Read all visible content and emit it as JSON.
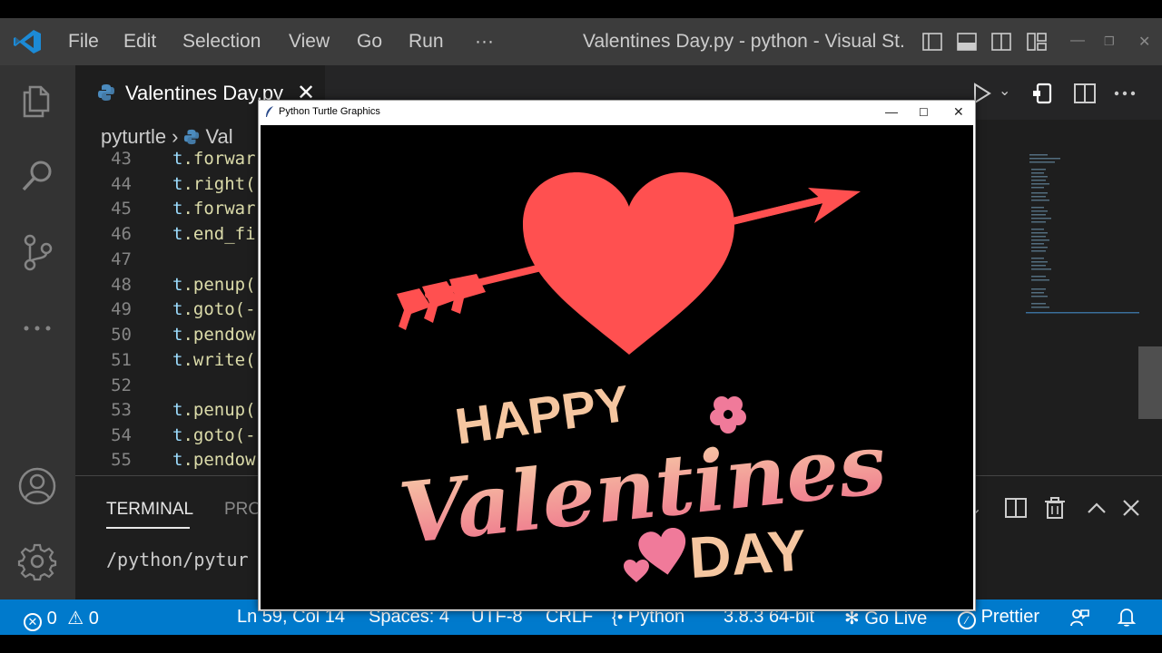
{
  "window": {
    "title": "Valentines Day.py - python - Visual St...",
    "menu": [
      "File",
      "Edit",
      "Selection",
      "View",
      "Go",
      "Run",
      "···"
    ]
  },
  "tab": {
    "label": "Valentines Day.py"
  },
  "breadcrumb": {
    "folder": "pyturtle",
    "file": "Val"
  },
  "code_lines": [
    {
      "num": "43",
      "obj": "t",
      "rest": ".forwar"
    },
    {
      "num": "44",
      "obj": "t",
      "rest": ".right("
    },
    {
      "num": "45",
      "obj": "t",
      "rest": ".forwar"
    },
    {
      "num": "46",
      "obj": "t",
      "rest": ".end_fi"
    },
    {
      "num": "47",
      "obj": "",
      "rest": ""
    },
    {
      "num": "48",
      "obj": "t",
      "rest": ".penup("
    },
    {
      "num": "49",
      "obj": "t",
      "rest": ".goto(-"
    },
    {
      "num": "50",
      "obj": "t",
      "rest": ".pendow"
    },
    {
      "num": "51",
      "obj": "t",
      "rest": ".write("
    },
    {
      "num": "52",
      "obj": "",
      "rest": ""
    },
    {
      "num": "53",
      "obj": "t",
      "rest": ".penup("
    },
    {
      "num": "54",
      "obj": "t",
      "rest": ".goto(-"
    },
    {
      "num": "55",
      "obj": "t",
      "rest": ".pendow"
    }
  ],
  "panel": {
    "terminal_tab": "TERMINAL",
    "problems_tab": "PRO",
    "terminal_text": "/python/pytur"
  },
  "statusbar": {
    "errors": "0",
    "warnings": "0",
    "position": "Ln 59, Col 14",
    "spaces": "Spaces: 4",
    "encoding": "UTF-8",
    "eol": "CRLF",
    "language": "Python",
    "interpreter": "3.8.3 64-bit",
    "golive": "Go Live",
    "prettier": "Prettier"
  },
  "turtle": {
    "title": "Python Turtle Graphics",
    "canvas_text": {
      "line1": "HAPPY",
      "line2": "Valentines",
      "line3": "DAY"
    }
  },
  "colors": {
    "statusbar": "#007acc",
    "heart": "#ff5050",
    "lettering_peach": "#f5c6a0",
    "lettering_pink": "#f07a8a",
    "flower": "#f07a9a"
  },
  "icons": {
    "explorer": "files-icon",
    "search": "search-icon",
    "scm": "source-control-icon",
    "more": "ellipsis-icon",
    "account": "account-icon",
    "settings": "gear-icon"
  }
}
